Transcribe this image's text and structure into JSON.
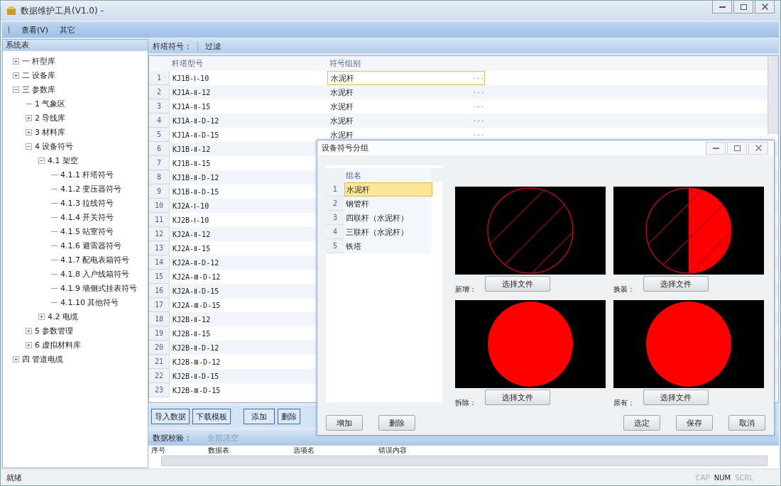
{
  "window": {
    "title": "数据维护工具(V1.0) -"
  },
  "menu": [
    "查看(V)",
    "其它"
  ],
  "sidebar": {
    "title": "系统表",
    "tree": [
      {
        "label": "一 杆型库",
        "expanded": false
      },
      {
        "label": "二 设备库",
        "expanded": false
      },
      {
        "label": "三 参数库",
        "expanded": true,
        "children": [
          {
            "label": "1 气象区"
          },
          {
            "label": "2 导线库",
            "expanded": false
          },
          {
            "label": "3 材料库",
            "expanded": false
          },
          {
            "label": "4 设备符号",
            "expanded": true,
            "children": [
              {
                "label": "4.1 架空",
                "expanded": true,
                "children": [
                  {
                    "label": "4.1.1 杆塔符号"
                  },
                  {
                    "label": "4.1.2 变压器符号"
                  },
                  {
                    "label": "4.1.3 拉线符号"
                  },
                  {
                    "label": "4.1.4 开关符号"
                  },
                  {
                    "label": "4.1.5 站室符号"
                  },
                  {
                    "label": "4.1.6 避雷器符号"
                  },
                  {
                    "label": "4.1.7 配电表箱符号"
                  },
                  {
                    "label": "4.1.8 入户线箱符号"
                  },
                  {
                    "label": "4.1.9 墙侧式挂表符号"
                  },
                  {
                    "label": "4.1.10 其他符号"
                  }
                ]
              },
              {
                "label": "4.2 电缆",
                "expanded": false
              }
            ]
          },
          {
            "label": "5 参数管理",
            "expanded": false
          },
          {
            "label": "6 虚拟材料库",
            "expanded": false
          }
        ]
      },
      {
        "label": "四 管道电缆",
        "expanded": false
      }
    ]
  },
  "toolbar": {
    "label": "杆塔符号：",
    "filter": "过滤"
  },
  "table": {
    "columns": [
      "杆塔型号",
      "符号组别"
    ],
    "rows": [
      {
        "n": "1",
        "model": "KJ1B-Ⅰ-10",
        "group": "水泥杆",
        "selected": true
      },
      {
        "n": "2",
        "model": "KJ1A-Ⅱ-12",
        "group": "水泥杆",
        "selected": false
      },
      {
        "n": "3",
        "model": "KJ1A-Ⅱ-15",
        "group": "水泥杆",
        "selected": false
      },
      {
        "n": "4",
        "model": "KJ1A-Ⅱ-D-12",
        "group": "水泥杆",
        "selected": false
      },
      {
        "n": "5",
        "model": "KJ1A-Ⅱ-D-15",
        "group": "水泥杆",
        "selected": false
      },
      {
        "n": "6",
        "model": "KJ1B-Ⅱ-12"
      },
      {
        "n": "7",
        "model": "KJ1B-Ⅱ-15"
      },
      {
        "n": "8",
        "model": "KJ1B-Ⅱ-D-12"
      },
      {
        "n": "9",
        "model": "KJ1B-Ⅱ-D-15"
      },
      {
        "n": "10",
        "model": "KJ2A-Ⅰ-10"
      },
      {
        "n": "11",
        "model": "KJ2B-Ⅰ-10"
      },
      {
        "n": "12",
        "model": "KJ2A-Ⅱ-12"
      },
      {
        "n": "13",
        "model": "KJ2A-Ⅱ-15"
      },
      {
        "n": "14",
        "model": "KJ2A-Ⅱ-D-12"
      },
      {
        "n": "15",
        "model": "KJ2A-Ⅲ-D-12"
      },
      {
        "n": "16",
        "model": "KJ2A-Ⅱ-D-15"
      },
      {
        "n": "17",
        "model": "KJ2A-Ⅲ-D-15"
      },
      {
        "n": "18",
        "model": "KJ2B-Ⅱ-12"
      },
      {
        "n": "19",
        "model": "KJ2B-Ⅱ-15"
      },
      {
        "n": "20",
        "model": "KJ2B-Ⅱ-D-12"
      },
      {
        "n": "21",
        "model": "KJ2B-Ⅲ-D-12"
      },
      {
        "n": "22",
        "model": "KJ2B-Ⅱ-D-15"
      },
      {
        "n": "23",
        "model": "KJ2B-Ⅲ-D-15"
      }
    ]
  },
  "actions": [
    "导入数据",
    "下载模板",
    "添加",
    "删除"
  ],
  "validation": {
    "label": "数据校验：",
    "clear": "全部清空",
    "columns": [
      "序号",
      "数据表",
      "选项名",
      "错误内容"
    ]
  },
  "status_bar": {
    "text": "就绪",
    "keys": [
      {
        "label": "CAP",
        "on": false
      },
      {
        "label": "NUM",
        "on": true
      },
      {
        "label": "SCRL",
        "on": false
      }
    ]
  },
  "dialog": {
    "title": "设备符号分组",
    "list_header": "组名",
    "groups": [
      {
        "n": "1",
        "name": "水泥杆",
        "selected": true
      },
      {
        "n": "2",
        "name": "钢管杆",
        "selected": false
      },
      {
        "n": "3",
        "name": "四联杆（水泥杆）",
        "selected": false
      },
      {
        "n": "4",
        "name": "三联杆（水泥杆）",
        "selected": false
      },
      {
        "n": "5",
        "name": "铁塔",
        "selected": false
      }
    ],
    "symbols": [
      {
        "kind": "hatched",
        "label": "新增：",
        "button": "选择文件"
      },
      {
        "kind": "half",
        "label": "换装：",
        "button": "选择文件"
      },
      {
        "kind": "solid",
        "label": "拆除：",
        "button": "选择文件"
      },
      {
        "kind": "solid",
        "label": "原有：",
        "button": "选择文件"
      }
    ],
    "left_buttons": [
      "增加",
      "删除"
    ],
    "right_buttons": [
      "选定",
      "保存",
      "取消"
    ]
  }
}
